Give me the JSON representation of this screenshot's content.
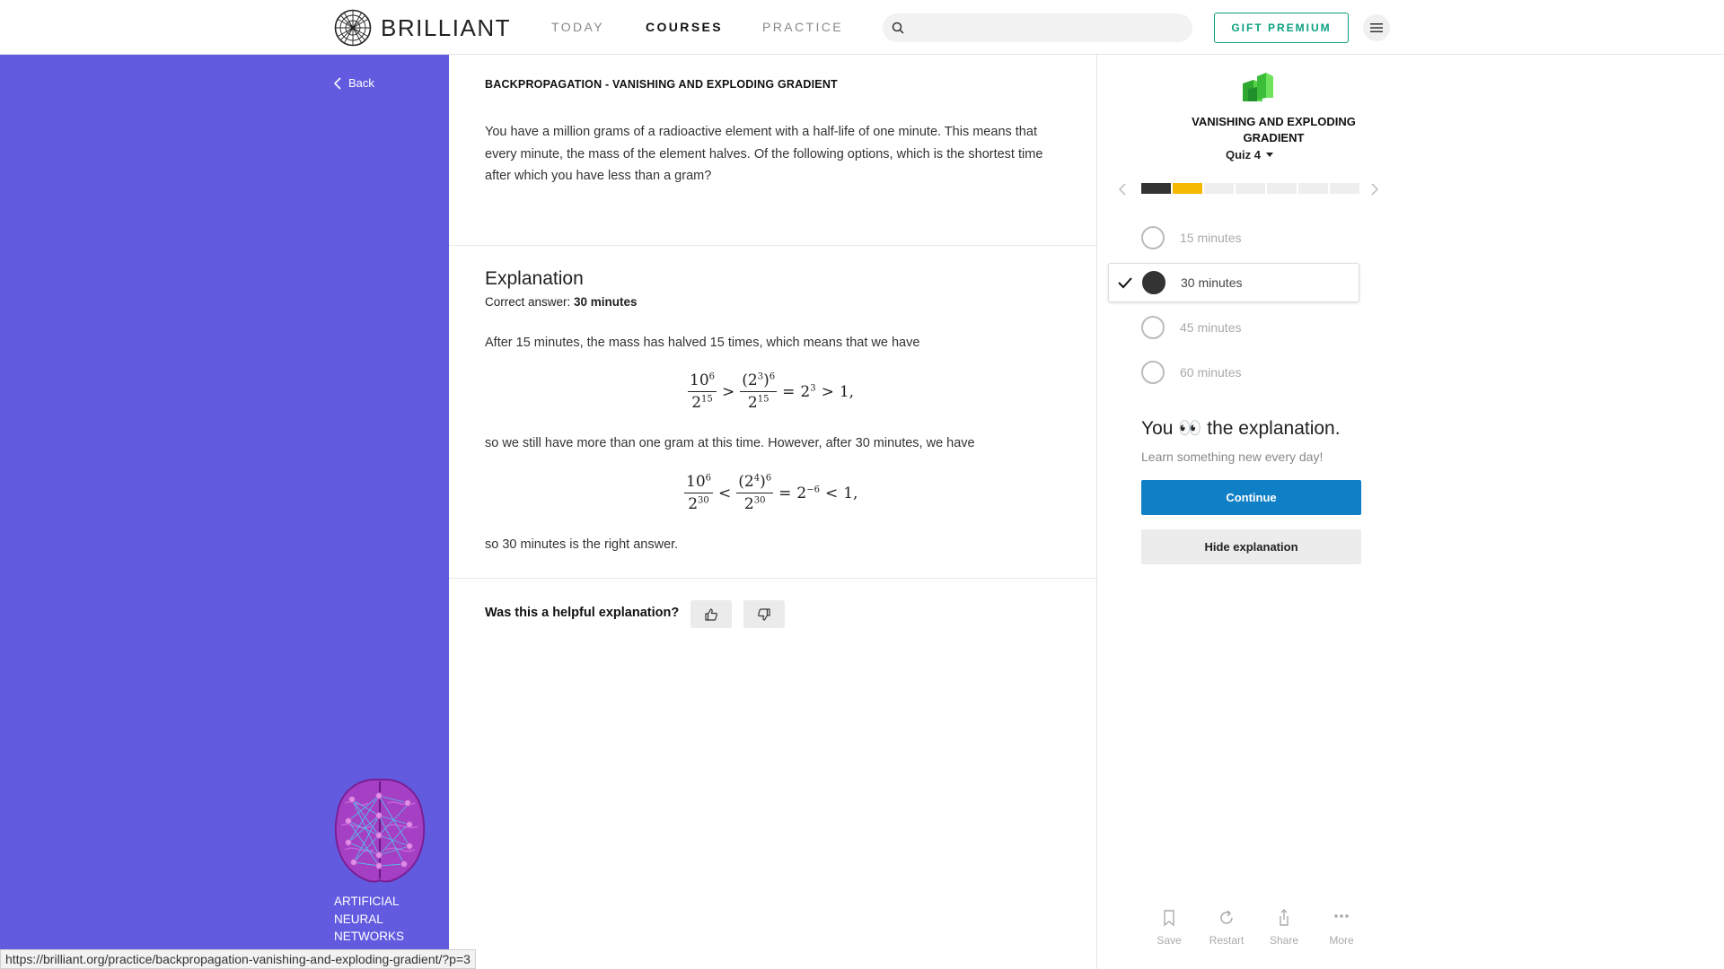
{
  "header": {
    "brand": "BRILLIANT",
    "nav": [
      {
        "label": "TODAY"
      },
      {
        "label": "COURSES"
      },
      {
        "label": "PRACTICE"
      }
    ],
    "search_placeholder": "",
    "gift_label": "GIFT PREMIUM"
  },
  "sidebar": {
    "back_label": "Back",
    "course_title": "ARTIFICIAL NEURAL NETWORKS"
  },
  "problem": {
    "title": "BACKPROPAGATION - VANISHING AND EXPLODING GRADIENT",
    "text": "You have a million grams of a radioactive element with a half-life of one minute. This means that every minute, the mass of the element halves. Of the following options, which is the shortest time after which you have less than a gram?"
  },
  "explanation": {
    "heading": "Explanation",
    "correct_prefix": "Correct answer: ",
    "correct_value": "30 minutes",
    "para1": "After 15 minutes, the mass has halved 15 times, which means that we have",
    "para2": "so we still have more than one gram at this time. However, after 30 minutes, we have",
    "para3": "so 30 minutes is the right answer.",
    "eq1": {
      "n1": "10",
      "n1e": "6",
      "d1": "2",
      "d1e": "15",
      "rel": ">",
      "n2a": "(2",
      "n2ae": "3",
      "n2b": ")",
      "n2be": "6",
      "d2": "2",
      "d2e": "15",
      "eq": "=",
      "r": "2",
      "re": "3",
      "rel2": ">",
      "end": "1,"
    },
    "eq2": {
      "n1": "10",
      "n1e": "6",
      "d1": "2",
      "d1e": "30",
      "rel": "<",
      "n2a": "(2",
      "n2ae": "4",
      "n2b": ")",
      "n2be": "6",
      "d2": "2",
      "d2e": "30",
      "eq": "=",
      "r": "2",
      "re": "−6",
      "rel2": "<",
      "end": "1,"
    }
  },
  "feedback": {
    "question": "Was this a helpful explanation?"
  },
  "quiz": {
    "title": "VANISHING AND EXPLODING GRADIENT",
    "quiz_label": "Quiz 4",
    "progress": {
      "segments": 7,
      "completed": 1,
      "current": 2
    },
    "colors": {
      "done": "#333333",
      "current": "#f5b800",
      "todo": "#eeeeee"
    },
    "options": [
      {
        "label": "15 minutes",
        "selected": false
      },
      {
        "label": "30 minutes",
        "selected": true
      },
      {
        "label": "45 minutes",
        "selected": false
      },
      {
        "label": "60 minutes",
        "selected": false
      }
    ],
    "you_text_before": "You",
    "you_emoji": "👀",
    "you_text_after": "the explanation.",
    "learn_text": "Learn something new every day!",
    "continue_label": "Continue",
    "hide_label": "Hide explanation"
  },
  "actions": [
    {
      "label": "Save",
      "icon": "bookmark-icon"
    },
    {
      "label": "Restart",
      "icon": "restart-icon"
    },
    {
      "label": "Share",
      "icon": "share-icon"
    },
    {
      "label": "More",
      "icon": "more-icon"
    }
  ],
  "status_url": "https://brilliant.org/practice/backpropagation-vanishing-and-exploding-gradient/?p=3"
}
